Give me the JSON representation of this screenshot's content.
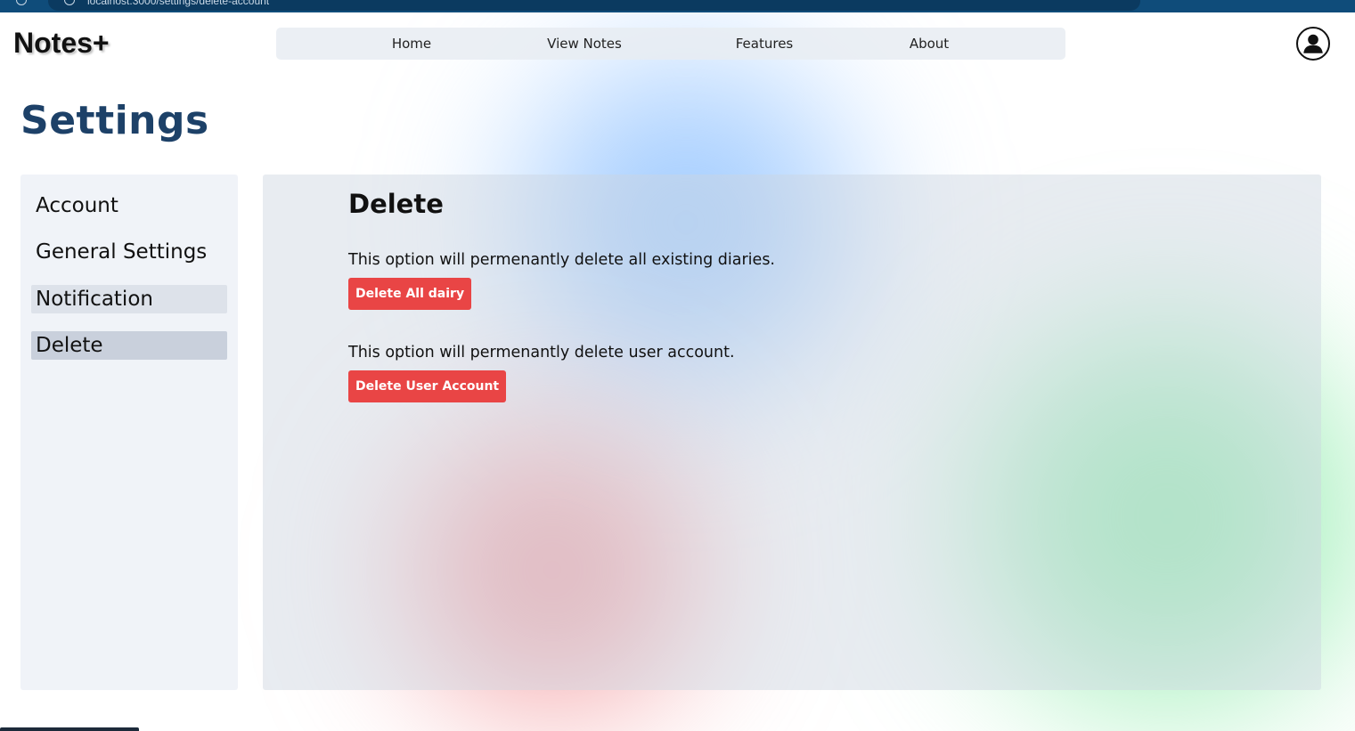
{
  "browser": {
    "url_text": "localhost:3000/settings/delete-account"
  },
  "header": {
    "logo": "Notes+",
    "nav": [
      "Home",
      "View Notes",
      "Features",
      "About"
    ],
    "avatar_icon": "user-circle-icon"
  },
  "page": {
    "title": "Settings"
  },
  "sidebar": {
    "items": [
      {
        "label": "Account"
      },
      {
        "label": "General Settings"
      },
      {
        "label": "Notification"
      },
      {
        "label": "Delete"
      }
    ]
  },
  "main": {
    "heading": "Delete",
    "sections": [
      {
        "description": "This option will permenantly delete all existing diaries.",
        "button_label": "Delete All dairy"
      },
      {
        "description": "This option will permenantly delete user account.",
        "button_label": "Delete User Account"
      }
    ]
  },
  "colors": {
    "title": "#1d4168",
    "danger": "#e94545",
    "browser_bar": "#0f4c7a"
  }
}
